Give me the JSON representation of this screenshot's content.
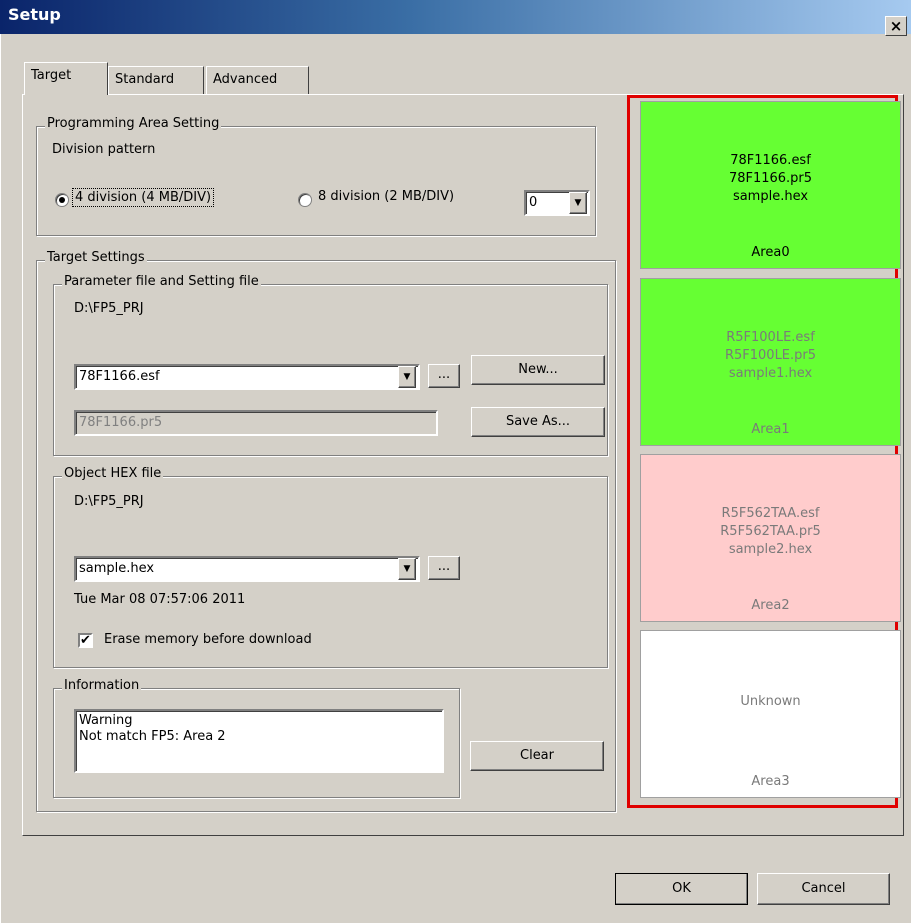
{
  "window": {
    "title": "Setup",
    "close_glyph": "×"
  },
  "tabs": [
    {
      "label": "Target",
      "active": true
    },
    {
      "label": "Standard",
      "active": false
    },
    {
      "label": "Advanced",
      "active": false
    }
  ],
  "programming_area": {
    "group_label": "Programming Area Setting",
    "division_label": "Division pattern",
    "option_4": "4 division (4 MB/DIV)",
    "option_8": "8 division (2 MB/DIV)",
    "selected_option": "4 division (4 MB/DIV)",
    "area_select_value": "0"
  },
  "target_settings": {
    "group_label": "Target Settings",
    "param": {
      "group_label": "Parameter file and Setting file",
      "path": "D:\\FP5_PRJ",
      "param_file": "78F1166.esf",
      "setting_file": "78F1166.pr5",
      "browse_label": "...",
      "new_label": "New...",
      "save_as_label": "Save As..."
    },
    "hex": {
      "group_label": "Object HEX file",
      "path": "D:\\FP5_PRJ",
      "hex_file": "sample.hex",
      "browse_label": "...",
      "timestamp": "Tue Mar 08 07:57:06 2011",
      "erase_label": "Erase memory before download",
      "erase_checked": true
    },
    "info": {
      "group_label": "Information",
      "line1": "Warning",
      "line2": "Not match FP5: Area 2",
      "clear_label": "Clear"
    }
  },
  "areas": [
    {
      "lines": [
        "78F1166.esf",
        "78F1166.pr5",
        "sample.hex"
      ],
      "label": "Area0",
      "color": "#66ff33",
      "muted": false
    },
    {
      "lines": [
        "R5F100LE.esf",
        "R5F100LE.pr5",
        "sample1.hex"
      ],
      "label": "Area1",
      "color": "#66ff33",
      "muted": true
    },
    {
      "lines": [
        "R5F562TAA.esf",
        "R5F562TAA.pr5",
        "sample2.hex"
      ],
      "label": "Area2",
      "color": "#ffcccc",
      "muted": true
    },
    {
      "lines": [
        "Unknown"
      ],
      "label": "Area3",
      "color": "#ffffff",
      "muted": true
    }
  ],
  "footer": {
    "ok_label": "OK",
    "cancel_label": "Cancel"
  },
  "icons": {
    "dropdown": "chevron-down-icon",
    "radio": "radio-icon",
    "check": "checkmark-icon"
  }
}
